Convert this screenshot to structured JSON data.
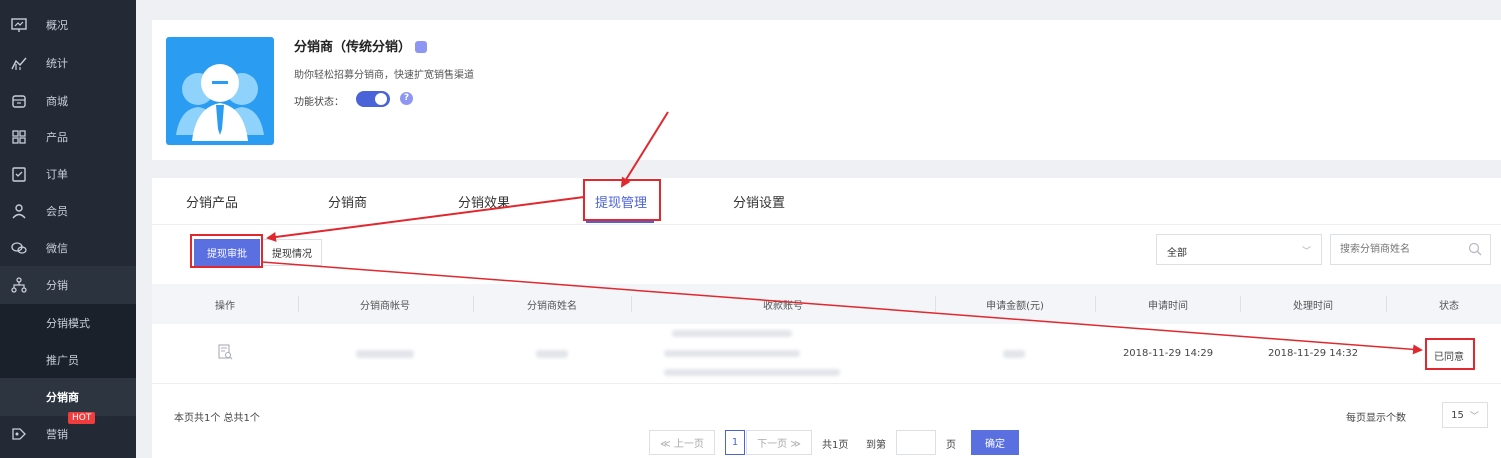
{
  "sidebar": {
    "items": [
      {
        "label": "概况",
        "icon": "dashboard-icon"
      },
      {
        "label": "统计",
        "icon": "chart-icon"
      },
      {
        "label": "商城",
        "icon": "store-icon"
      },
      {
        "label": "产品",
        "icon": "grid-icon"
      },
      {
        "label": "订单",
        "icon": "order-icon"
      },
      {
        "label": "会员",
        "icon": "member-icon"
      },
      {
        "label": "微信",
        "icon": "wechat-icon"
      },
      {
        "label": "分销",
        "icon": "distribution-icon"
      }
    ],
    "subitems": [
      {
        "label": "分销模式"
      },
      {
        "label": "推广员"
      },
      {
        "label": "分销商"
      }
    ],
    "marketing": {
      "label": "营销",
      "badge": "HOT",
      "icon": "marketing-icon"
    }
  },
  "app_card": {
    "title": "分销商（传统分销）",
    "description": "助你轻松招募分销商，快速扩宽销售渠道",
    "status_label": "功能状态：",
    "status_on": true,
    "help": "?"
  },
  "tabs": [
    {
      "label": "分销产品"
    },
    {
      "label": "分销商"
    },
    {
      "label": "分销效果"
    },
    {
      "label": "提现管理"
    },
    {
      "label": "分销设置"
    }
  ],
  "subtabs": {
    "approve": "提现审批",
    "status": "提现情况"
  },
  "filter": {
    "selected": "全部",
    "search_placeholder": "搜索分销商姓名"
  },
  "table": {
    "headers": [
      "操作",
      "分销商帐号",
      "分销商姓名",
      "收款账号",
      "申请金额(元)",
      "申请时间",
      "处理时间",
      "状态"
    ],
    "rows": [
      {
        "apply_time": "2018-11-29 14:29",
        "process_time": "2018-11-29 14:32",
        "status": "已同意"
      }
    ]
  },
  "footer": {
    "summary": "本页共1个  总共1个",
    "prev": "≪ 上一页",
    "page": "1",
    "next": "下一页 ≫",
    "total_pages": "共1页",
    "goto": "到第",
    "page_unit": "页",
    "confirm": "确定",
    "per_page_label": "每页显示个数",
    "per_page_value": "15"
  },
  "colors": {
    "accent": "#4b63d9",
    "sidebar_bg": "#232a36",
    "annotation": "#e0282e",
    "logo_bg": "#2a9cf2"
  }
}
